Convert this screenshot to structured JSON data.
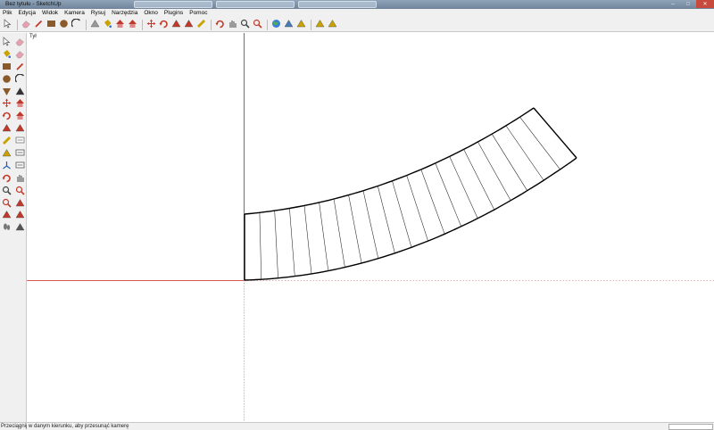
{
  "window": {
    "title": "Bez tytułu - SketchUp",
    "controls": {
      "minimize": "–",
      "maximize": "□",
      "close": "✕"
    },
    "title_bar_color": "#7a8ea5"
  },
  "menu": {
    "items": [
      {
        "label": "Plik"
      },
      {
        "label": "Edycja"
      },
      {
        "label": "Widok"
      },
      {
        "label": "Kamera"
      },
      {
        "label": "Rysuj"
      },
      {
        "label": "Narzędzia"
      },
      {
        "label": "Okno"
      },
      {
        "label": "Plugins"
      },
      {
        "label": "Pomoc"
      }
    ]
  },
  "toolbar": {
    "groups": [
      [
        "select-icon"
      ],
      [
        "eraser-icon",
        "pencil-icon",
        "rectangle-icon",
        "circle-icon",
        "arc-icon"
      ],
      [
        "make-component-icon",
        "paint-bucket-icon",
        "push-pull-icon",
        "follow-me-icon"
      ],
      [
        "move-icon",
        "rotate-icon",
        "offset-icon",
        "scale-icon",
        "tape-measure-icon"
      ],
      [
        "orbit-icon",
        "pan-icon",
        "zoom-icon",
        "zoom-extents-icon"
      ],
      [
        "google-earth-icon",
        "photo-texture-icon",
        "get-models-icon"
      ],
      [
        "component-warehouse-icon",
        "share-model-icon"
      ]
    ]
  },
  "sidebar": {
    "icons": [
      "select-icon",
      "eraser-icon",
      "paint-bucket-icon",
      "eraser-alt-icon",
      "rectangle-icon",
      "pencil-icon",
      "circle-icon",
      "arc-icon",
      "polygon-icon",
      "freehand-icon",
      "move-icon",
      "push-pull-icon",
      "rotate-icon",
      "follow-me-icon",
      "scale-icon",
      "offset-icon",
      "tape-measure-icon",
      "dimension-icon",
      "protractor-icon",
      "text-icon",
      "axes-icon",
      "3d-text-icon",
      "orbit-icon",
      "pan-icon",
      "zoom-icon",
      "zoom-window-icon",
      "zoom-extents-icon",
      "previous-view-icon",
      "position-camera-icon",
      "look-around-icon",
      "walk-icon",
      "section-plane-icon"
    ]
  },
  "canvas": {
    "scene_label": "Tył",
    "axis_colors": {
      "red": "#d21f1f",
      "blue": "#3a3ad6",
      "green_dotted": "#9ab59a"
    },
    "model": {
      "type": "curved-stair-ramp",
      "divisions": 20
    }
  },
  "status": {
    "text": "Przeciągnij w danym kierunku, aby przesunąć kamerę",
    "vcb_value": ""
  }
}
